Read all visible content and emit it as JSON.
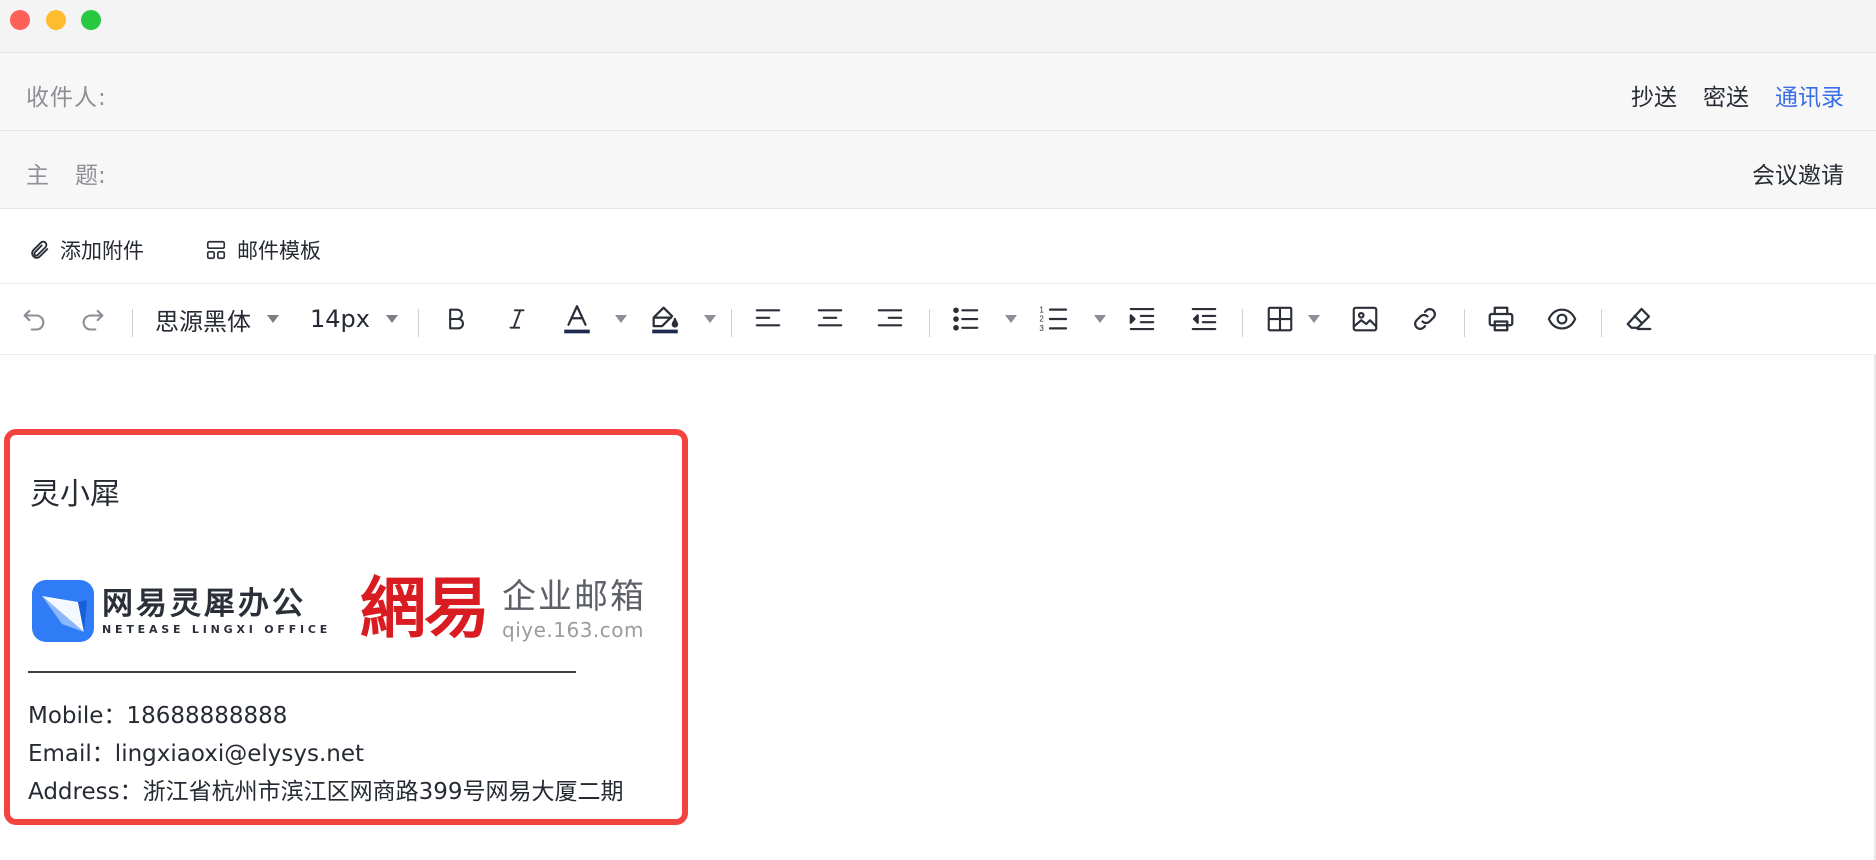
{
  "header": {
    "to_label": "收件人:",
    "cc_label": "抄送",
    "bcc_label": "密送",
    "contacts_label": "通讯录",
    "subject_label_a": "主",
    "subject_label_b": "题:",
    "template_label": "会议邀请"
  },
  "attach_bar": {
    "add_attachment": "添加附件",
    "mail_template": "邮件模板"
  },
  "toolbar": {
    "font_family": "思源黑体",
    "font_size": "14px",
    "icons": [
      "undo-icon",
      "redo-icon",
      "bold-icon",
      "italic-icon",
      "font-color-icon",
      "highlight-icon",
      "align-left-icon",
      "align-center-icon",
      "align-right-icon",
      "bullet-list-icon",
      "numbered-list-icon",
      "indent-icon",
      "outdent-icon",
      "table-icon",
      "image-icon",
      "link-icon",
      "print-icon",
      "preview-icon",
      "clear-format-icon"
    ]
  },
  "signature": {
    "name": "灵小犀",
    "brand_lingxi_cn": "网易灵犀办公",
    "brand_lingxi_en": "NETEASE LINGXI OFFICE",
    "brand_163": "網易",
    "brand_qiye_cn": "企业邮箱",
    "brand_qiye_url": "qiye.163.com",
    "mobile": "Mobile：18688888888",
    "email": "Email：lingxiaoxi@elysys.net",
    "address": "Address：浙江省杭州市滨江区网商路399号网易大厦二期"
  },
  "colors": {
    "accent_link": "#386ee7",
    "highlight_border": "#f2433f",
    "brand_red": "#d81c21",
    "brand_blue": "#2f7cf6"
  }
}
